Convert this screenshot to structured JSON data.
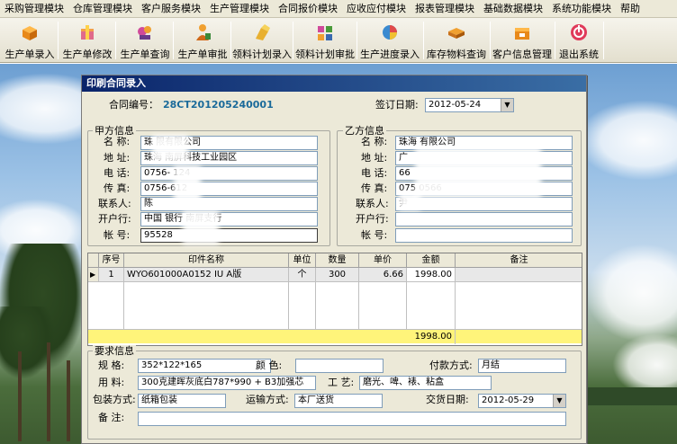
{
  "menubar": {
    "items": [
      "采购管理模块",
      "仓库管理模块",
      "客户服务模块",
      "生产管理模块",
      "合同报价模块",
      "应收应付模块",
      "报表管理模块",
      "基础数据模块",
      "系统功能模块",
      "帮助"
    ]
  },
  "toolbar": {
    "buttons": [
      {
        "label": "生产单录入",
        "icon": "box-orange-icon"
      },
      {
        "label": "生产单修改",
        "icon": "package-edit-icon"
      },
      {
        "label": "生产单查询",
        "icon": "magnifier-query-icon"
      },
      {
        "label": "生产单审批",
        "icon": "approve-person-icon"
      },
      {
        "label": "领料计划录入",
        "icon": "material-entry-icon"
      },
      {
        "label": "领料计划审批",
        "icon": "material-approve-icon"
      },
      {
        "label": "生产进度录入",
        "icon": "progress-pie-icon"
      },
      {
        "label": "库存物料查询",
        "icon": "inventory-icon"
      },
      {
        "label": "客户信息管理",
        "icon": "customer-box-icon"
      },
      {
        "label": "退出系统",
        "icon": "exit-power-icon"
      }
    ]
  },
  "dialog": {
    "title": "印刷合同录入",
    "contract_no_label": "合同编号：",
    "contract_no": "28CT201205240001",
    "sign_date_label": "签订日期:",
    "sign_date": "2012-05-24",
    "party_a": {
      "title": "甲方信息",
      "name_label": "名 称:",
      "name": "珠      限有限公司",
      "addr_label": "地 址:",
      "addr": "珠海      南屏科技工业园区",
      "tel_label": "电 话:",
      "tel": "0756-  124",
      "fax_label": "传 真:",
      "fax": "0756-612",
      "contact_label": "联系人:",
      "contact": "陈",
      "bank_label": "开户行:",
      "bank": "中国    银行    南屏支行",
      "account_label": "帐 号:",
      "account": "95528"
    },
    "party_b": {
      "title": "乙方信息",
      "name_label": "名 称:",
      "name": "珠海      有限公司",
      "addr_label": "地 址:",
      "addr": "广",
      "tel_label": "电 话:",
      "tel": "66",
      "fax_label": "传 真:",
      "fax": "075      0566",
      "contact_label": "联系人:",
      "contact": "尹",
      "bank_label": "开户行:",
      "bank": "",
      "account_label": "帐 号:",
      "account": ""
    },
    "grid": {
      "headers": [
        "序号",
        "印件名称",
        "单位",
        "数量",
        "单价",
        "金额",
        "备注"
      ],
      "rows": [
        {
          "no": "1",
          "name": "WYO601000A0152  IU  A版",
          "unit": "个",
          "qty": "300",
          "price": "6.66",
          "amount": "1998.00",
          "remark": ""
        }
      ],
      "total_amount": "1998.00"
    },
    "requirements": {
      "title": "要求信息",
      "spec_label": "规 格:",
      "spec": "352*122*165",
      "color_label": "颜 色:",
      "color": "",
      "payment_label": "付款方式:",
      "payment": "月结",
      "material_label": "用 料:",
      "material": "300克建晖灰底白787*990 + B3加强芯",
      "process_label": "工 艺:",
      "process": "磨光、啤、裱、粘盒",
      "packing_label": "包装方式:",
      "packing": "纸箱包装",
      "transport_label": "运输方式:",
      "transport": "本厂送货",
      "delivery_label": "交货日期:",
      "delivery": "2012-05-29",
      "remark_label": "备 注:",
      "remark": ""
    }
  },
  "colors": {
    "title_bar": "#0a246a",
    "total_row": "#fff47a",
    "code_text": "#1a6a9a"
  }
}
